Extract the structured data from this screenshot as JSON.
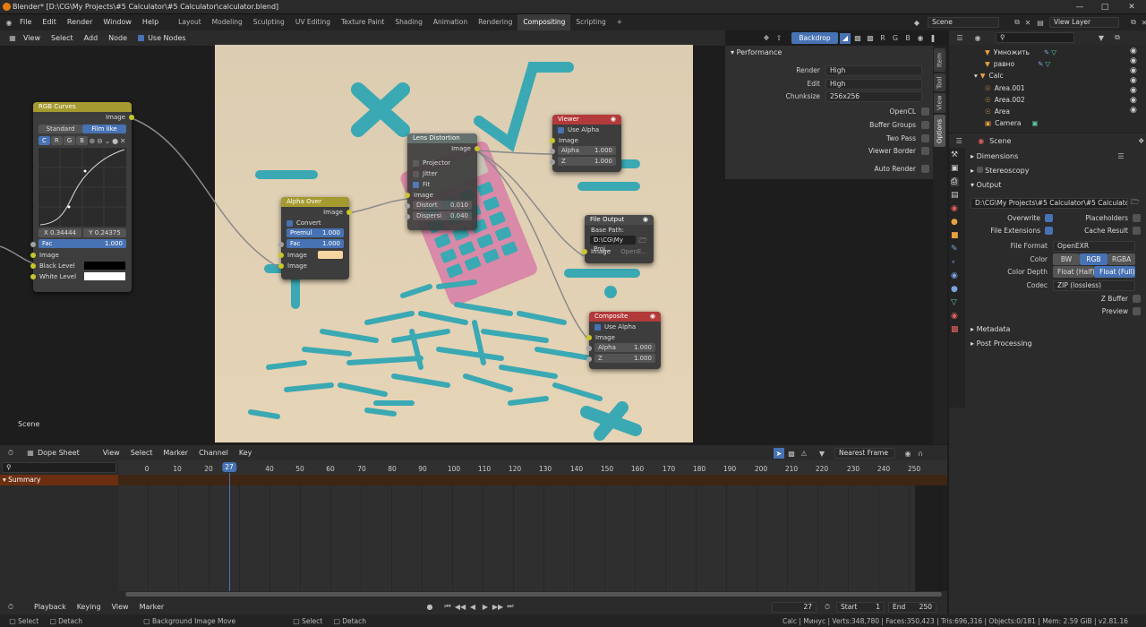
{
  "title": "Blender* [D:\\CG\\My Projects\\#5 Calculator\\#5 Calculator\\calculator.blend]",
  "menu": [
    "File",
    "Edit",
    "Render",
    "Window",
    "Help"
  ],
  "workspaces": [
    "Layout",
    "Modeling",
    "Sculpting",
    "UV Editing",
    "Texture Paint",
    "Shading",
    "Animation",
    "Rendering",
    "Compositing",
    "Scripting",
    "+"
  ],
  "scene_name": "Scene",
  "view_layer": "View Layer",
  "node_header": {
    "menu": [
      "View",
      "Select",
      "Add",
      "Node"
    ],
    "use_nodes": "Use Nodes",
    "backdrop": "Backdrop",
    "channels": [
      "R",
      "G",
      "B"
    ]
  },
  "side_tabs": [
    "Item",
    "Tool",
    "View",
    "Options"
  ],
  "performance": {
    "title": "Performance",
    "render_label": "Render",
    "render_value": "High",
    "edit_label": "Edit",
    "edit_value": "High",
    "chunk_label": "Chunksize",
    "chunk_value": "256x256",
    "opencl": "OpenCL",
    "buffer_groups": "Buffer Groups",
    "two_pass": "Two Pass",
    "viewer_border": "Viewer Border",
    "auto_render": "Auto Render"
  },
  "nodes": {
    "rgb_curves": {
      "title": "RGB Curves",
      "out": "Image",
      "standard": "Standard",
      "filmlike": "Film like",
      "chans": [
        "C",
        "R",
        "G",
        "B"
      ],
      "x": "X 0.34444",
      "y": "Y 0.24375",
      "fac": "Fac",
      "fac_val": "1.000",
      "image": "Image",
      "black": "Black Level",
      "white": "White Level"
    },
    "alpha_over": {
      "title": "Alpha Over",
      "out": "Image",
      "convert": "Convert Premul",
      "premul": "Premul",
      "premul_val": "1.000",
      "fac": "Fac",
      "fac_val": "1.000",
      "img1": "Image",
      "img2": "Image"
    },
    "lens": {
      "title": "Lens Distortion",
      "out": "Image",
      "projector": "Projector",
      "jitter": "Jitter",
      "fit": "Fit",
      "image": "Image",
      "distort": "Distort",
      "distort_val": "0.010",
      "dispersion": "Dispersi",
      "dispersion_val": "0.040"
    },
    "viewer": {
      "title": "Viewer",
      "use_alpha": "Use Alpha",
      "image": "Image",
      "alpha": "Alpha",
      "alpha_val": "1.000",
      "z": "Z",
      "z_val": "1.000"
    },
    "file_output": {
      "title": "File Output",
      "base": "Base Path:",
      "path": "D:\\CG\\My Proj...",
      "image": "Image",
      "ext": "OpenE..."
    },
    "composite": {
      "title": "Composite",
      "use_alpha": "Use Alpha",
      "image": "Image",
      "alpha": "Alpha",
      "alpha_val": "1.000",
      "z": "Z",
      "z_val": "1.000"
    }
  },
  "scene_label": "Scene",
  "outliner": {
    "items": [
      "Умножить",
      "равно",
      "Calc",
      "Area.001",
      "Area.002",
      "Area",
      "Camera"
    ]
  },
  "properties": {
    "scene": "Scene",
    "dimensions": "Dimensions",
    "stereoscopy": "Stereoscopy",
    "output": "Output",
    "path": "D:\\CG\\My Projects\\#5 Calculator\\#5 Calculator\\ve...",
    "overwrite": "Overwrite",
    "placeholders": "Placeholders",
    "file_ext": "File Extensions",
    "cache_result": "Cache Result",
    "file_format_label": "File Format",
    "file_format": "OpenEXR",
    "color_label": "Color",
    "color_opts": [
      "BW",
      "RGB",
      "RGBA"
    ],
    "depth_label": "Color Depth",
    "depth_opts": [
      "Float (Half)",
      "Float (Full)"
    ],
    "codec_label": "Codec",
    "codec": "ZIP (lossless)",
    "zbuffer": "Z Buffer",
    "preview": "Preview",
    "metadata": "Metadata",
    "post": "Post Processing"
  },
  "dopesheet": {
    "mode": "Dope Sheet",
    "menu": [
      "View",
      "Select",
      "Marker",
      "Channel",
      "Key"
    ],
    "summary": "Summary",
    "snap": "Nearest Frame",
    "frames": [
      "0",
      "10",
      "20",
      "27",
      "40",
      "50",
      "60",
      "70",
      "80",
      "90",
      "100",
      "110",
      "120",
      "130",
      "140",
      "150",
      "160",
      "170",
      "180",
      "190",
      "200",
      "210",
      "220",
      "230",
      "240",
      "250"
    ]
  },
  "playback": {
    "menu": [
      "Playback",
      "Keying",
      "View",
      "Marker"
    ],
    "current": "27",
    "start_label": "Start",
    "start": "1",
    "end_label": "End",
    "end": "250"
  },
  "status": {
    "select": "Select",
    "detach": "Detach",
    "bg_move": "Background Image Move",
    "select2": "Select",
    "detach2": "Detach",
    "info": "Calc | Минус | Verts:348,780 | Faces:350,423 | Tris:696,316 | Objects:0/181 | Mem: 2.59 GiB | v2.81.16"
  },
  "colors": {
    "accent": "#4772b3",
    "canvas_bg": "#d9cbb0",
    "teal": "#3aa9b3",
    "yellow_header": "#a59a2f"
  }
}
